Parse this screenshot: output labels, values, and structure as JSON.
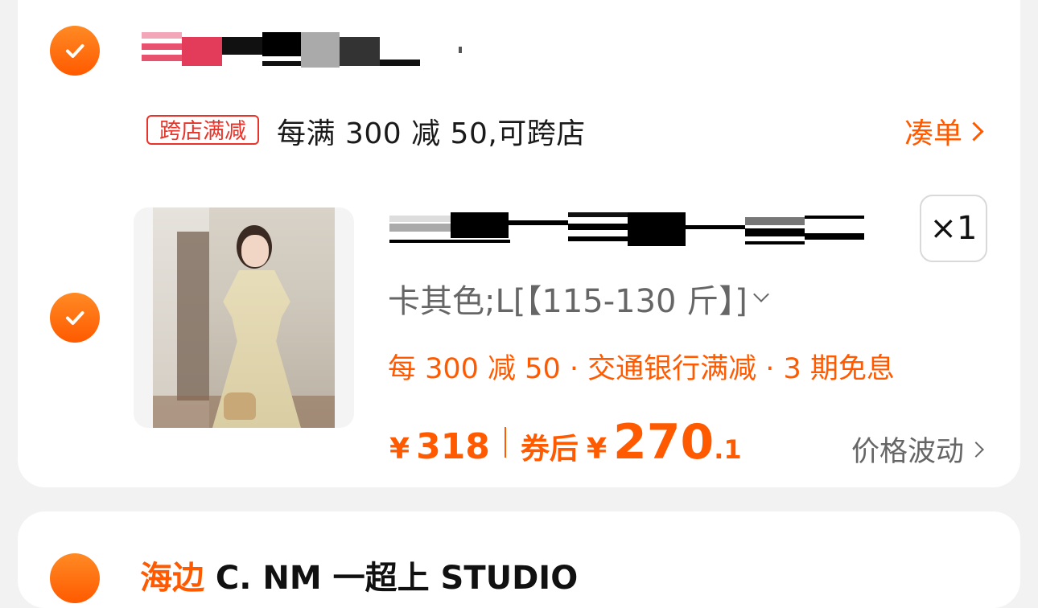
{
  "shop": {
    "promo_tag": "跨店满减",
    "promo_text": "每满 300 减 50,可跨店",
    "gather_link": "凑单"
  },
  "item": {
    "quantity": "×1",
    "sku": "卡其色;L[【115-130 斤】]",
    "offers": "每 300 减 50 · 交通银行满减 · 3 期免息",
    "price_symbol": "¥",
    "price": "318",
    "after_coupon_label": "券后",
    "after_coupon_symbol": "¥",
    "after_coupon_int": "270",
    "after_coupon_dec": ".1",
    "price_trend": "价格波动"
  },
  "next_shop": {
    "name_highlight": "海边",
    "name_rest": " C. NM 一超上 STUDIO"
  },
  "colors": {
    "accent": "#ff5a00",
    "tag_red": "#e8332a"
  }
}
